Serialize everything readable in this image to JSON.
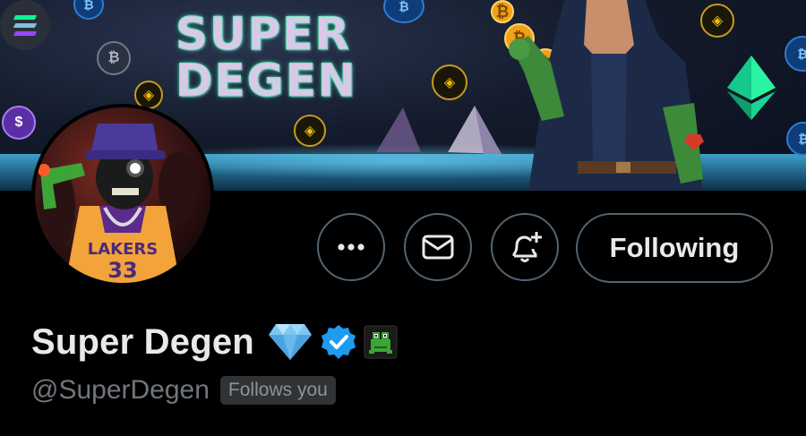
{
  "banner": {
    "title_line1": "SUPER",
    "title_line2": "DEGEN",
    "coin_glyphs": {
      "btc": "₿",
      "bnb": "◈",
      "purple": "$"
    },
    "icons": [
      "solana-logo-icon",
      "bitcoin-coin-icon",
      "bnb-coin-icon",
      "ethereum-diamond-icon"
    ]
  },
  "profile": {
    "display_name": "Super Degen",
    "handle": "@SuperDegen",
    "follows_you_label": "Follows you",
    "name_icons": [
      "diamond-emoji-icon",
      "verified-badge-icon",
      "frog-emoji-icon"
    ]
  },
  "actions": {
    "more_icon": "more-dots-icon",
    "message_icon": "envelope-icon",
    "notify_icon": "bell-plus-icon",
    "following_label": "Following"
  },
  "colors": {
    "background": "#000000",
    "text_primary": "#e7e9ea",
    "text_secondary": "#71767b",
    "button_border": "#536471",
    "verified_blue": "#1d9bf0",
    "badge_bg": "#2f3336"
  }
}
